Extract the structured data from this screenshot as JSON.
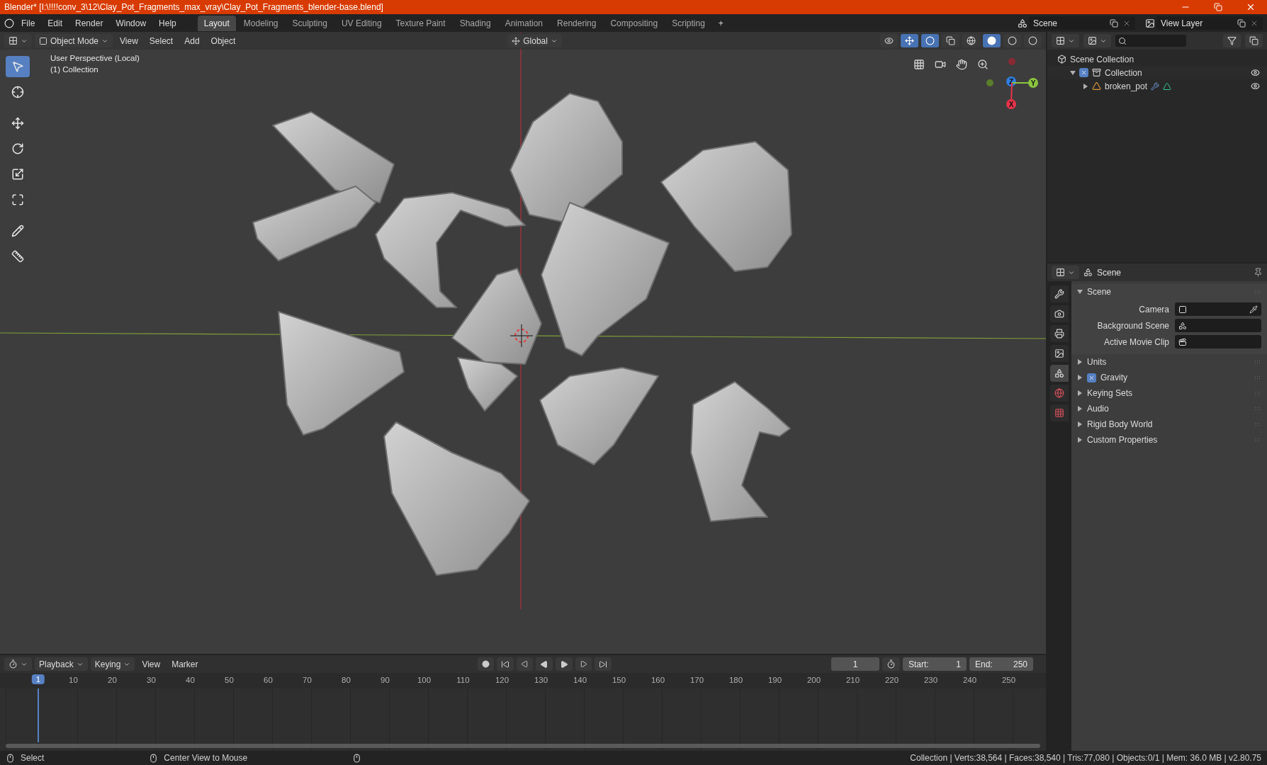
{
  "window": {
    "title": "Blender* [I:\\!!!!conv_3\\12\\Clay_Pot_Fragments_max_vray\\Clay_Pot_Fragments_blender-base.blend]"
  },
  "menu": [
    "File",
    "Edit",
    "Render",
    "Window",
    "Help"
  ],
  "workspaces": [
    {
      "label": "Layout",
      "selected": true
    },
    {
      "label": "Modeling",
      "selected": false
    },
    {
      "label": "Sculpting",
      "selected": false
    },
    {
      "label": "UV Editing",
      "selected": false
    },
    {
      "label": "Texture Paint",
      "selected": false
    },
    {
      "label": "Shading",
      "selected": false
    },
    {
      "label": "Animation",
      "selected": false
    },
    {
      "label": "Rendering",
      "selected": false
    },
    {
      "label": "Compositing",
      "selected": false
    },
    {
      "label": "Scripting",
      "selected": false
    }
  ],
  "add_workspace": "+",
  "scene": "Scene",
  "view_layer": "View Layer",
  "viewport": {
    "mode": "Object Mode",
    "menus": [
      "View",
      "Select",
      "Add",
      "Object"
    ],
    "orientation": "Global",
    "tools": [
      {
        "kind": "select",
        "selected": true
      },
      {
        "kind": "cursor",
        "selected": false
      },
      {
        "kind": "move",
        "selected": false
      },
      {
        "kind": "rotate",
        "selected": false
      },
      {
        "kind": "scale",
        "selected": false
      },
      {
        "kind": "transform",
        "selected": false
      },
      {
        "kind": "annotate",
        "selected": false
      },
      {
        "kind": "measure",
        "selected": false
      }
    ],
    "overlay_text": [
      "User Perspective (Local)",
      "(1) Collection"
    ],
    "gizmo": [
      {
        "label": "Z",
        "color": "#2f7de0"
      },
      {
        "label": "Y",
        "color": "#8bc53f"
      },
      {
        "label": "X",
        "color": "#e8334a"
      }
    ]
  },
  "outliner": {
    "items": [
      {
        "label": "Scene Collection",
        "kind": "scene_collection",
        "children": [
          {
            "label": "Collection",
            "kind": "collection",
            "checked": true,
            "expanded": true,
            "visible": true,
            "children": [
              {
                "label": "broken_pot",
                "kind": "mesh_object",
                "expanded": false,
                "visible": true
              }
            ]
          }
        ]
      }
    ]
  },
  "properties": {
    "title": "Scene",
    "tabs": [
      {
        "kind": "tool",
        "selected": false
      },
      {
        "kind": "render",
        "selected": false
      },
      {
        "kind": "output",
        "selected": false
      },
      {
        "kind": "view_layer",
        "selected": false
      },
      {
        "kind": "scene",
        "selected": true
      },
      {
        "kind": "world",
        "selected": false
      },
      {
        "kind": "texture",
        "selected": false
      }
    ],
    "panel": {
      "title": "Scene",
      "expanded": true,
      "fields": [
        {
          "label": "Camera",
          "kind": "camera"
        },
        {
          "label": "Background Scene",
          "kind": "scene"
        },
        {
          "label": "Active Movie Clip",
          "kind": "clip"
        }
      ]
    },
    "sections": [
      {
        "label": "Units",
        "kind": "plain",
        "expanded": false
      },
      {
        "label": "Gravity",
        "kind": "checkbox",
        "checked": true,
        "expanded": false
      },
      {
        "label": "Keying Sets",
        "kind": "plain",
        "expanded": false
      },
      {
        "label": "Audio",
        "kind": "plain",
        "expanded": false
      },
      {
        "label": "Rigid Body World",
        "kind": "plain",
        "expanded": false
      },
      {
        "label": "Custom Properties",
        "kind": "plain",
        "expanded": false
      }
    ]
  },
  "timeline": {
    "menus": [
      "Playback",
      "Keying",
      "View",
      "Marker"
    ],
    "current_frame": "1",
    "start_label": "Start:",
    "start": "1",
    "end_label": "End:",
    "end": "250",
    "ruler": [
      "1",
      "10",
      "20",
      "30",
      "40",
      "50",
      "60",
      "70",
      "80",
      "90",
      "100",
      "110",
      "120",
      "130",
      "140",
      "150",
      "160",
      "170",
      "180",
      "190",
      "200",
      "210",
      "220",
      "230",
      "240",
      "250"
    ]
  },
  "status_bar": {
    "hints": [
      "Select",
      "Center View to Mouse"
    ],
    "stats": "Collection | Verts:38,564 | Faces:38,540 | Tris:77,080 | Objects:0/1 | Mem: 36.0 MB | v2.80.75"
  }
}
